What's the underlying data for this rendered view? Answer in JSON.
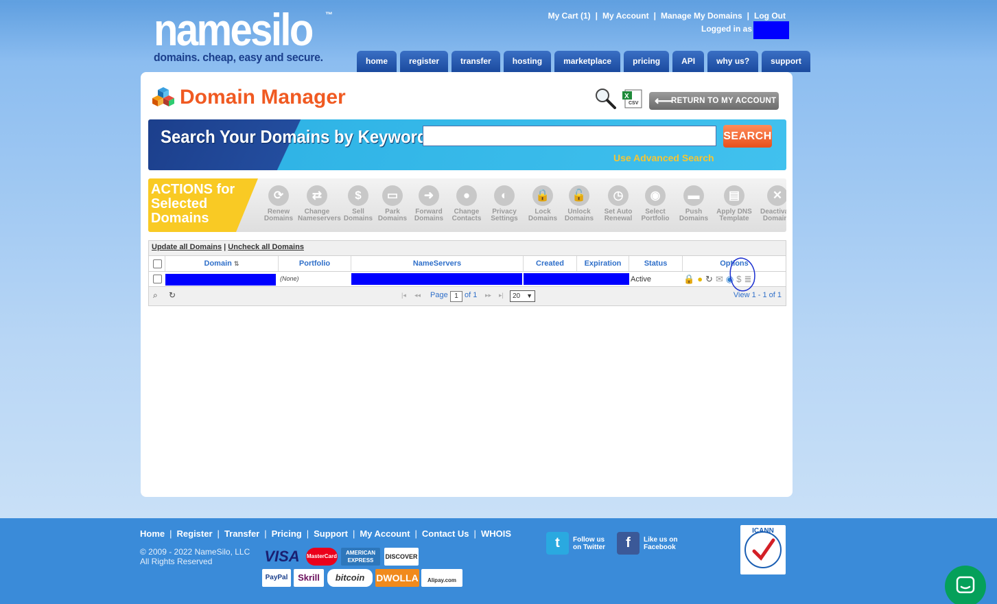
{
  "logo": {
    "word": "namesilo",
    "tm": "™",
    "tagline": "domains. cheap, easy and secure."
  },
  "toplinks": [
    "My Cart (1)",
    "My Account",
    "Manage My Domains",
    "Log Out"
  ],
  "logged_in_label": "Logged in as",
  "nav": [
    "home",
    "register",
    "transfer",
    "hosting",
    "marketplace",
    "pricing",
    "API",
    "why us?",
    "support"
  ],
  "page_title": "Domain Manager",
  "csv_label": "CSV",
  "return_button": "RETURN TO MY ACCOUNT",
  "search": {
    "title": "Search Your Domains by Keyword",
    "button": "SEARCH",
    "advanced": "Use Advanced Search",
    "value": ""
  },
  "actions": {
    "label_lines": [
      "ACTIONS for",
      "Selected",
      "Domains"
    ],
    "items": [
      {
        "l1": "Renew",
        "l2": "Domains",
        "icon": "renew-icon",
        "g": "⟳"
      },
      {
        "l1": "Change",
        "l2": "Nameservers",
        "icon": "change-nameservers-icon",
        "g": "⇄"
      },
      {
        "l1": "Sell",
        "l2": "Domains",
        "icon": "dollar-icon",
        "g": "$"
      },
      {
        "l1": "Park",
        "l2": "Domains",
        "icon": "park-icon",
        "g": "▭"
      },
      {
        "l1": "Forward",
        "l2": "Domains",
        "icon": "forward-arrow-icon",
        "g": "➜"
      },
      {
        "l1": "Change",
        "l2": "Contacts",
        "icon": "contacts-icon",
        "g": "●"
      },
      {
        "l1": "Privacy",
        "l2": "Settings",
        "icon": "privacy-icon",
        "g": "◐"
      },
      {
        "l1": "Lock",
        "l2": "Domains",
        "icon": "lock-icon",
        "g": "🔒"
      },
      {
        "l1": "Unlock",
        "l2": "Domains",
        "icon": "unlock-icon",
        "g": "🔓"
      },
      {
        "l1": "Set Auto",
        "l2": "Renewal",
        "icon": "clock-icon",
        "g": "◷"
      },
      {
        "l1": "Select",
        "l2": "Portfolio",
        "icon": "portfolio-icon",
        "g": "◉"
      },
      {
        "l1": "Push",
        "l2": "Domains",
        "icon": "push-icon",
        "g": "▬"
      },
      {
        "l1": "Apply DNS",
        "l2": "Template",
        "icon": "dns-template-icon",
        "g": "▤"
      },
      {
        "l1": "Deactivate",
        "l2": "Domains",
        "icon": "deactivate-icon",
        "g": "✕"
      }
    ]
  },
  "grid": {
    "update_all": "Update all Domains",
    "sep": "|",
    "uncheck_all": "Uncheck all Domains",
    "headers": [
      "Domain",
      "Portfolio",
      "NameServers",
      "Created",
      "Expiration",
      "Status",
      "Options"
    ],
    "row": {
      "portfolio": "(None)",
      "status": "Active"
    },
    "pager": {
      "page_label": "Page",
      "page_value": "1",
      "of_label": "of 1",
      "rows_per_page": "20",
      "view": "View 1 - 1 of 1"
    }
  },
  "footer": {
    "links": [
      "Home",
      "Register",
      "Transfer",
      "Pricing",
      "Support",
      "My Account",
      "Contact Us",
      "WHOIS"
    ],
    "copyright": "© 2009 - 2022 NameSilo, LLC",
    "rights": "All Rights Reserved",
    "twitter": [
      "Follow us",
      "on Twitter"
    ],
    "facebook": [
      "Like us on",
      "Facebook"
    ],
    "payments_row1": [
      "VISA",
      "MasterCard",
      "AMERICAN EXPRESS",
      "DISCOVER"
    ],
    "payments_row2": [
      "PayPal",
      "Skrill",
      "bitcoin",
      "DWOLLA",
      "Alipay.com"
    ],
    "icann": "ICANN Accredited Registrar"
  }
}
